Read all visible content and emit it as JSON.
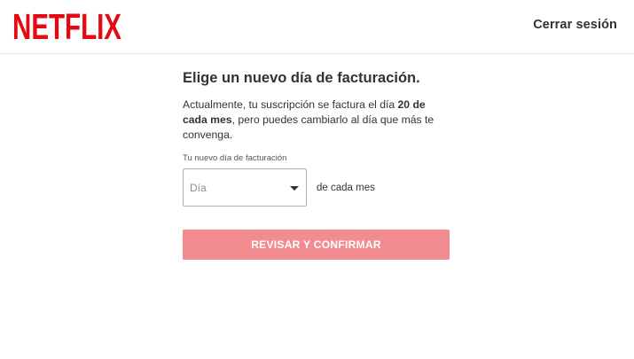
{
  "header": {
    "logo_text": "NETFLIX",
    "brand_color": "#e50914",
    "signout_label": "Cerrar sesión"
  },
  "main": {
    "title": "Elige un nuevo día de facturación.",
    "description": {
      "part1": "Actualmente, tu suscripción se factura el día ",
      "bold": "20 de cada mes",
      "part2": ", pero puedes cambiarlo al día que más te convenga."
    },
    "field_label": "Tu nuevo día de facturación",
    "select": {
      "placeholder": "Día"
    },
    "select_suffix": "de cada mes",
    "confirm_label": "REVISAR Y CONFIRMAR",
    "confirm_color": "#f38c91"
  }
}
